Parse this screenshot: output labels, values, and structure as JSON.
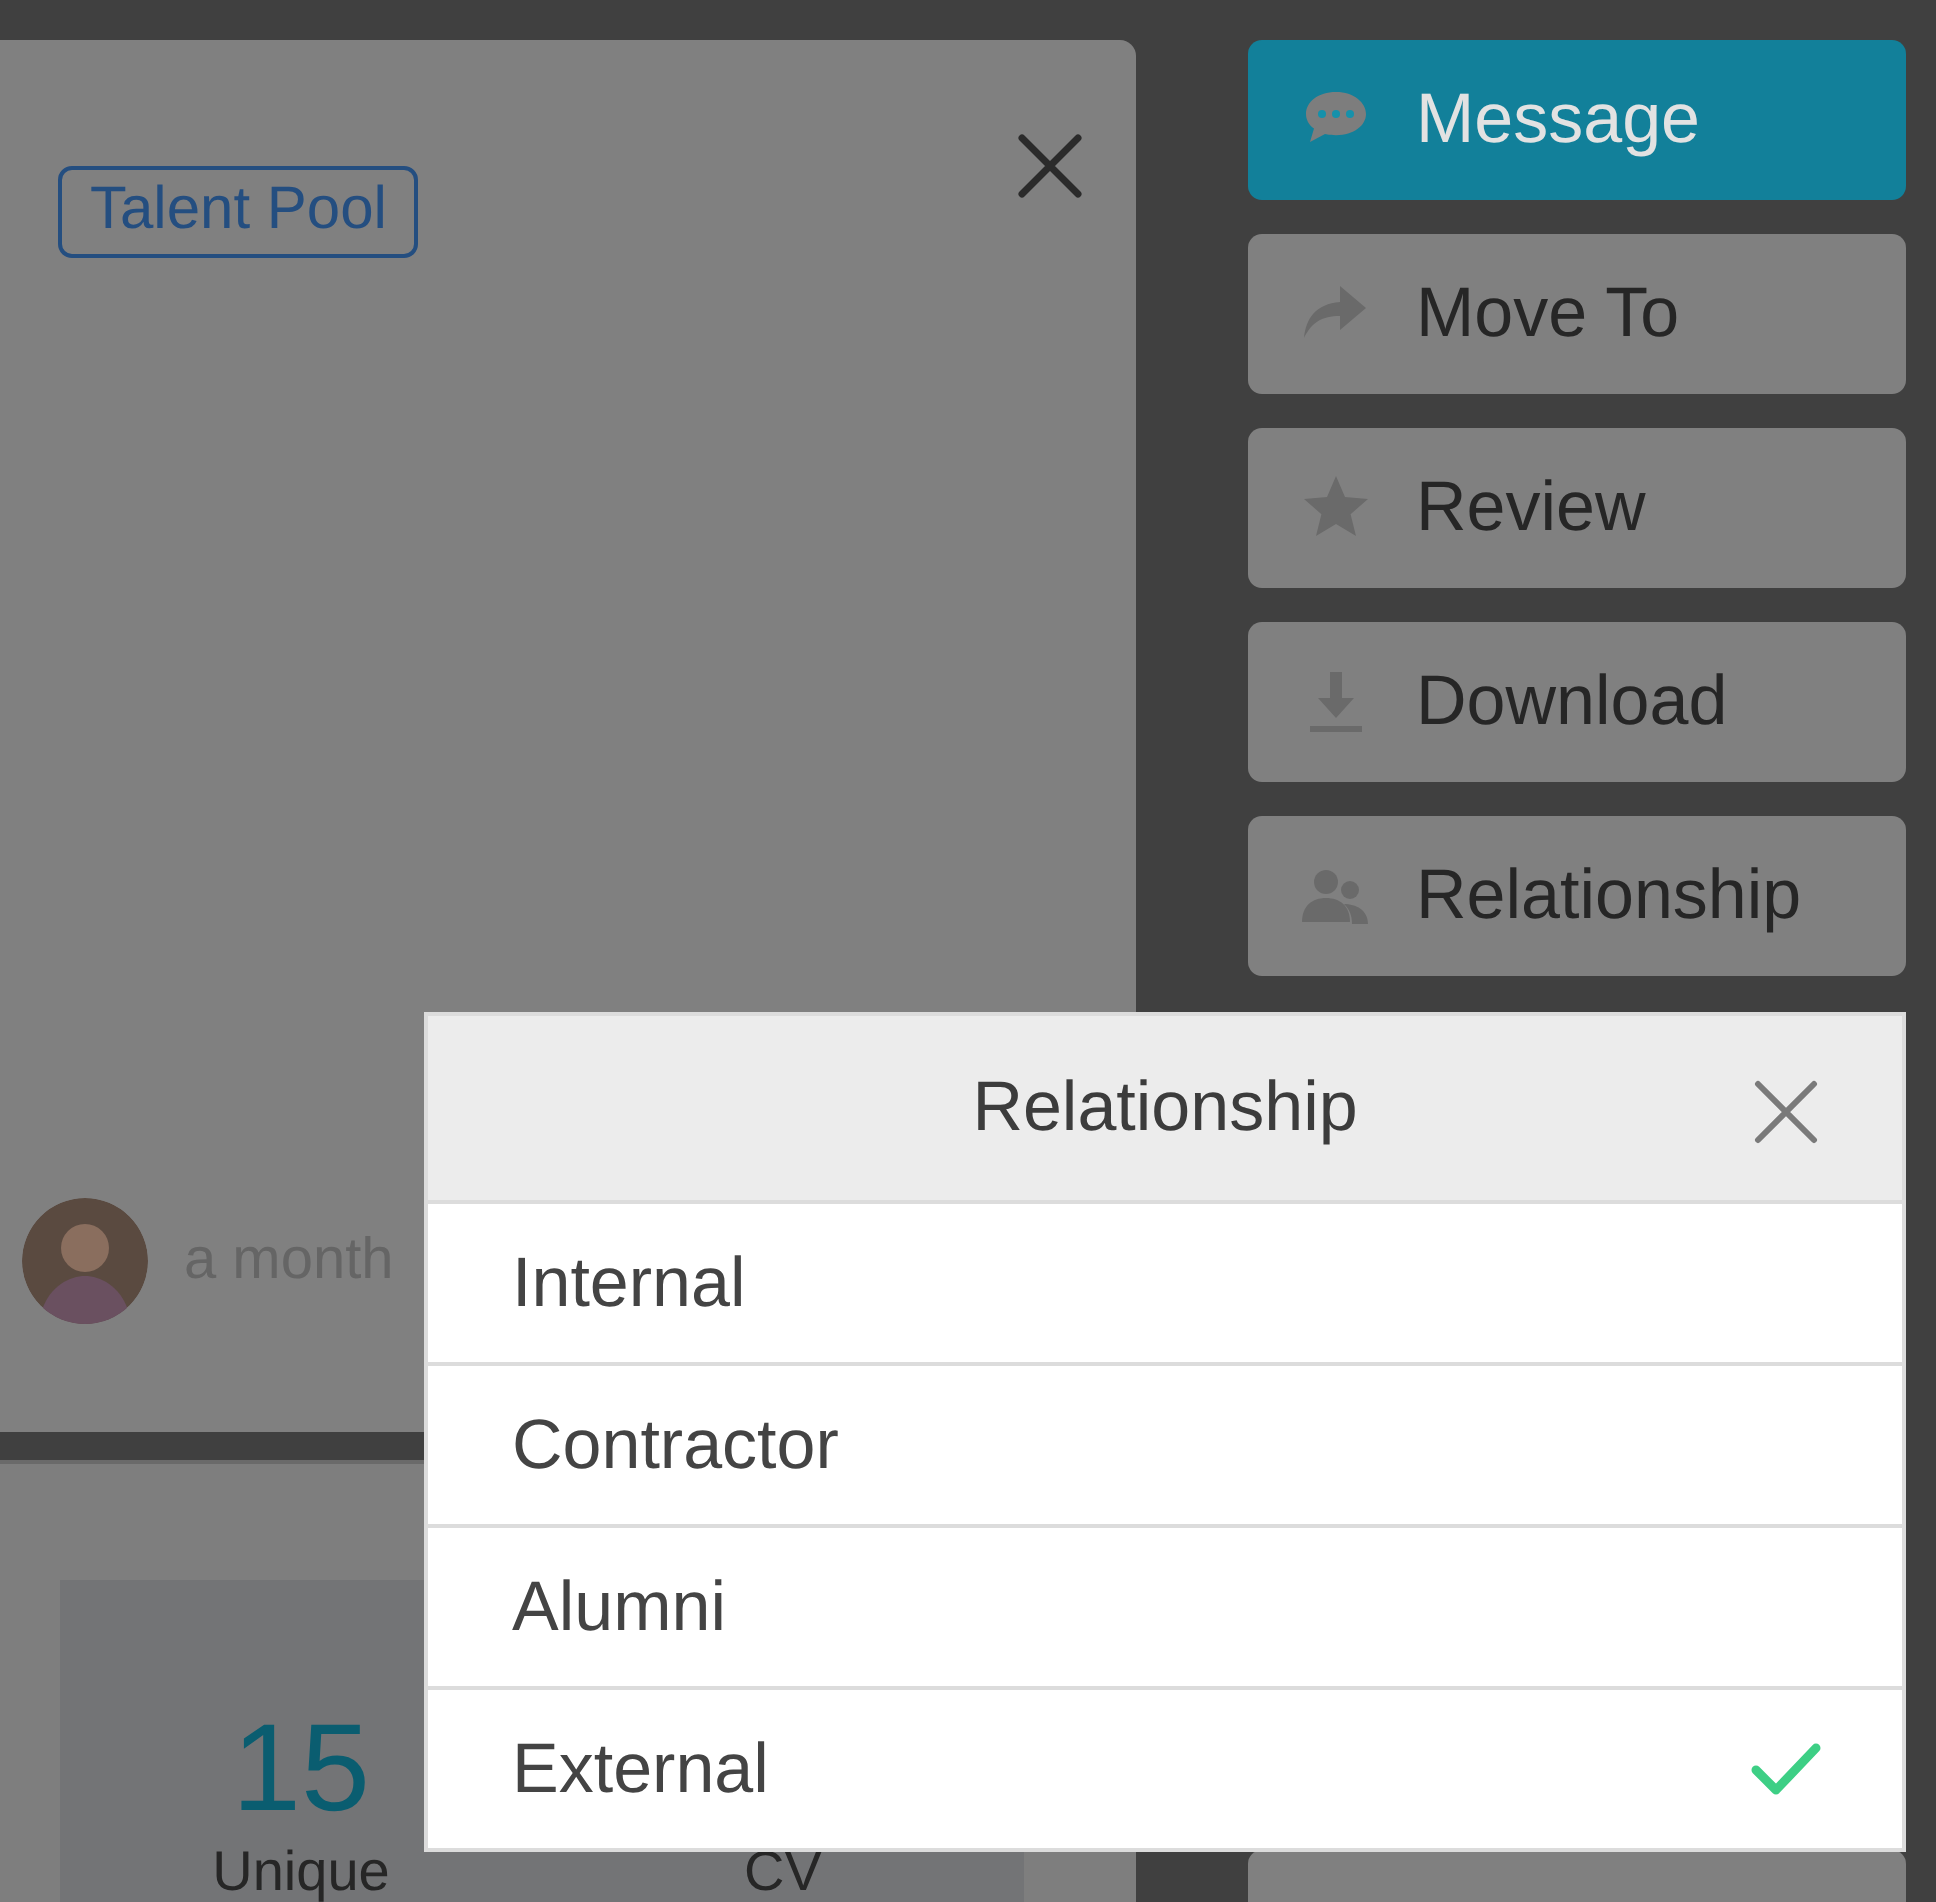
{
  "profile_panel": {
    "tag": "Talent Pool",
    "activity": {
      "time": "a month"
    },
    "stats": [
      {
        "value": "15",
        "label": "Unique"
      },
      {
        "label": "CV"
      }
    ]
  },
  "actions": [
    {
      "label": "Message",
      "kind": "primary"
    },
    {
      "label": "Move To",
      "kind": "default"
    },
    {
      "label": "Review",
      "kind": "default"
    },
    {
      "label": "Download",
      "kind": "default"
    },
    {
      "label": "Relationship",
      "kind": "default"
    },
    {
      "kind": "partial"
    }
  ],
  "dialog": {
    "title": "Relationship",
    "options": [
      {
        "label": "Internal",
        "selected": false
      },
      {
        "label": "Contractor",
        "selected": false
      },
      {
        "label": "Alumni",
        "selected": false
      },
      {
        "label": "External",
        "selected": true
      }
    ]
  }
}
